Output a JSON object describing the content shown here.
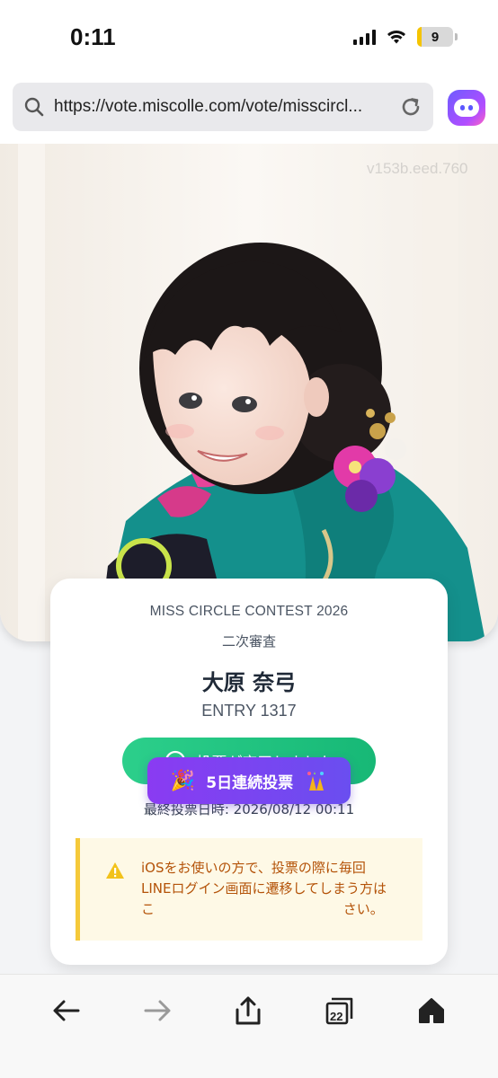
{
  "status_bar": {
    "time": "0:11",
    "battery": "9"
  },
  "browser": {
    "url": "https://vote.miscolle.com/vote/misscircl..."
  },
  "watermark": "v153b.eed.760",
  "card": {
    "contest": "MISS CIRCLE CONTEST 2026",
    "stage": "二次審査",
    "name": "大原 奈弓",
    "entry": "ENTRY 1317",
    "voted_label": "投票が完了しました",
    "last_vote": "最終投票日時: 2026/08/12 00:11",
    "notice_line1": "iOSをお使いの方で、投票の際に毎回",
    "notice_line2": "LINEログイン画面に遷移してしまう方は",
    "notice_line3": "こ                                            さい。"
  },
  "streak_button": {
    "label": "5日連続投票",
    "emoji": "🎉"
  },
  "toolbar": {
    "tabs_count": "22"
  },
  "colors": {
    "accent_green": "#1fbf80",
    "accent_purple": "#7c3aed",
    "notice_bg": "#fef9e6",
    "notice_text": "#b45309"
  },
  "icons": [
    "search-icon",
    "reload-icon",
    "assistant-icon",
    "check-circle-icon",
    "warning-icon",
    "back-icon",
    "forward-icon",
    "share-icon",
    "tabs-icon",
    "home-icon"
  ]
}
